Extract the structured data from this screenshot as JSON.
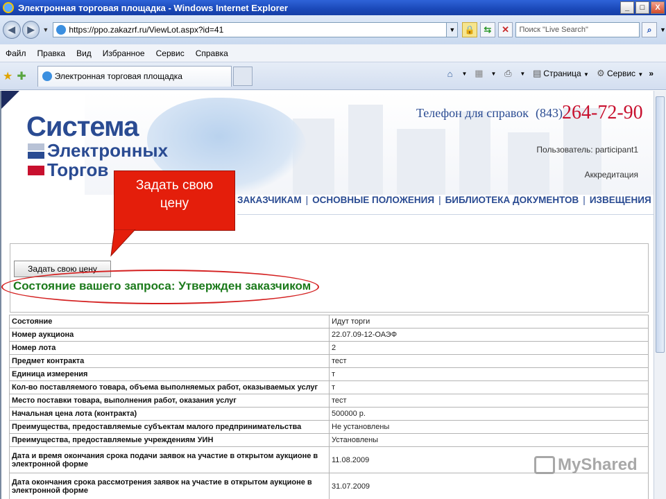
{
  "window": {
    "title": "Электронная торговая площадка - Windows Internet Explorer",
    "min": "_",
    "max": "□",
    "close": "X"
  },
  "address": {
    "url": "https://ppo.zakazrf.ru/ViewLot.aspx?id=41",
    "search_placeholder": "Поиск \"Live Search\""
  },
  "menu": [
    "Файл",
    "Правка",
    "Вид",
    "Избранное",
    "Сервис",
    "Справка"
  ],
  "tab": {
    "title": "Электронная торговая площадка"
  },
  "commandbar": {
    "page": "Страница",
    "tools": "Сервис"
  },
  "site": {
    "logo": [
      "Система",
      "Электронных",
      "Торгов"
    ],
    "phone_label": "Телефон для справок",
    "phone_code": "(843)",
    "phone_number": "264-72-90",
    "user": "Пользователь: participant1",
    "accreditation": "Аккредитация",
    "nav": [
      "ЗАКАЗЧИКАМ",
      "ОСНОВНЫЕ ПОЛОЖЕНИЯ",
      "БИБЛИОТЕКА ДОКУМЕНТОВ",
      "ИЗВЕЩЕНИЯ О ЗАКАЗАХ"
    ]
  },
  "callout": {
    "line1": "Задать свою",
    "line2": "цену"
  },
  "bid_button": "Задать свою цену",
  "status_title": "Состояние вашего запроса: Утвержден заказчиком",
  "lot_rows": [
    {
      "key": "Состояние",
      "value": "Идут торги"
    },
    {
      "key": "Номер аукциона",
      "value": "22.07.09-12-ОАЭФ"
    },
    {
      "key": "Номер лота",
      "value": "2"
    },
    {
      "key": "Предмет контракта",
      "value": "тест"
    },
    {
      "key": "Единица измерения",
      "value": "т"
    },
    {
      "key": "Кол-во поставляемого товара, объема выполняемых работ, оказываемых услуг",
      "value": "т"
    },
    {
      "key": "Место поставки товара, выполнения работ, оказания услуг",
      "value": "тест"
    },
    {
      "key": "Начальная цена лота (контракта)",
      "value": "500000 р."
    },
    {
      "key": "Преимущества, предоставляемые субъектам малого предпринимательства",
      "value": "Не установлены"
    },
    {
      "key": "Преимущества, предоставляемые учреждениям УИН",
      "value": "Установлены"
    },
    {
      "key": "Дата и время окончания срока подачи заявок на участие в открытом аукционе в электронной форме",
      "value": "11.08.2009"
    },
    {
      "key": "Дата окончания срока рассмотрения заявок на участие в открытом аукционе в электронной форме",
      "value": "31.07.2009"
    }
  ],
  "watermark": "MyShared",
  "colors": {
    "brand_blue": "#2a4b92",
    "phone_red": "#c8102e",
    "status_green": "#1b7a1b",
    "callout_red": "#e41e0b"
  }
}
